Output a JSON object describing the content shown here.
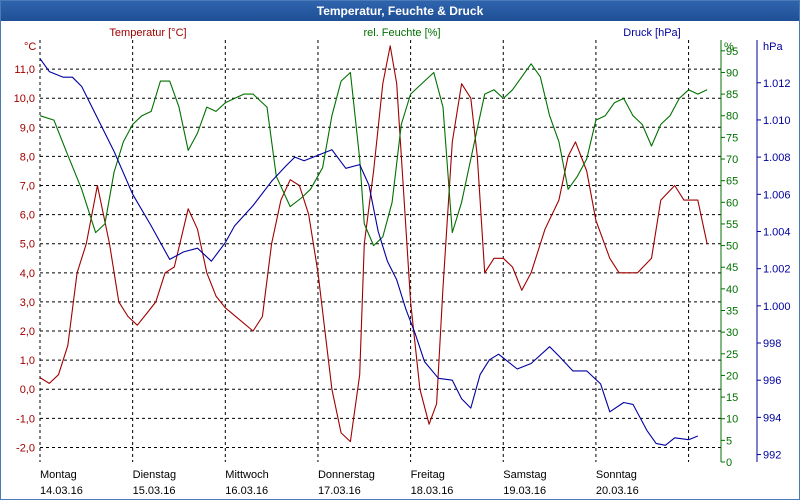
{
  "window": {
    "title": "Temperatur, Feuchte & Druck"
  },
  "colors": {
    "temp": "#a00000",
    "hum": "#007000",
    "press": "#0000a0",
    "grid": "#000000"
  },
  "chart_data": {
    "type": "line",
    "grid": true,
    "x": {
      "unit": "days",
      "range": [
        0,
        7.35
      ],
      "ticks": [
        {
          "value": 0,
          "day": "Montag",
          "date": "14.03.16"
        },
        {
          "value": 1,
          "day": "Dienstag",
          "date": "15.03.16"
        },
        {
          "value": 2,
          "day": "Mittwoch",
          "date": "16.03.16"
        },
        {
          "value": 3,
          "day": "Donnerstag",
          "date": "17.03.16"
        },
        {
          "value": 4,
          "day": "Freitag",
          "date": "18.03.16"
        },
        {
          "value": 5,
          "day": "Samstag",
          "date": "19.03.16"
        },
        {
          "value": 6,
          "day": "Sonntag",
          "date": "20.03.16"
        },
        {
          "value": 7,
          "day": "",
          "date": ""
        }
      ]
    },
    "axes": {
      "temp": {
        "unit_label": "°C",
        "range": [
          -2.5,
          12.0
        ],
        "ticks": [
          "-2,0",
          "-1,0",
          "0,0",
          "1,0",
          "2,0",
          "3,0",
          "4,0",
          "5,0",
          "6,0",
          "7,0",
          "8,0",
          "9,0",
          "10,0",
          "11,0"
        ]
      },
      "hum": {
        "unit_label": "%",
        "range": [
          0,
          97.5
        ],
        "ticks": [
          "0",
          "5",
          "10",
          "15",
          "20",
          "25",
          "30",
          "35",
          "40",
          "45",
          "50",
          "55",
          "60",
          "65",
          "70",
          "75",
          "80",
          "85",
          "90",
          "95"
        ]
      },
      "press": {
        "unit_label": "hPa",
        "range": [
          991.6,
          1014.3
        ],
        "ticks": [
          "992",
          "994",
          "996",
          "998",
          "1.000",
          "1.002",
          "1.004",
          "1.006",
          "1.008",
          "1.010",
          "1.012"
        ]
      }
    },
    "series": [
      {
        "name": "Temperatur [°C]",
        "axis": "temp",
        "points": [
          [
            0,
            0.4
          ],
          [
            0.1,
            0.2
          ],
          [
            0.2,
            0.5
          ],
          [
            0.3,
            1.5
          ],
          [
            0.4,
            4.0
          ],
          [
            0.5,
            5.0
          ],
          [
            0.62,
            7.0
          ],
          [
            0.75,
            5.0
          ],
          [
            0.85,
            3.0
          ],
          [
            0.95,
            2.5
          ],
          [
            1.05,
            2.2
          ],
          [
            1.15,
            2.6
          ],
          [
            1.25,
            3.0
          ],
          [
            1.35,
            4.0
          ],
          [
            1.45,
            4.2
          ],
          [
            1.6,
            6.2
          ],
          [
            1.7,
            5.5
          ],
          [
            1.8,
            4.0
          ],
          [
            1.9,
            3.2
          ],
          [
            2.0,
            2.8
          ],
          [
            2.15,
            2.4
          ],
          [
            2.3,
            2.0
          ],
          [
            2.4,
            2.5
          ],
          [
            2.5,
            5.0
          ],
          [
            2.6,
            6.5
          ],
          [
            2.7,
            7.2
          ],
          [
            2.8,
            7.0
          ],
          [
            2.9,
            6.0
          ],
          [
            3.0,
            4.0
          ],
          [
            3.15,
            0.0
          ],
          [
            3.25,
            -1.5
          ],
          [
            3.35,
            -1.8
          ],
          [
            3.45,
            0.5
          ],
          [
            3.5,
            5.0
          ],
          [
            3.6,
            7.5
          ],
          [
            3.7,
            10.5
          ],
          [
            3.78,
            11.8
          ],
          [
            3.85,
            10.5
          ],
          [
            3.92,
            7.0
          ],
          [
            4.0,
            3.0
          ],
          [
            4.1,
            0.0
          ],
          [
            4.2,
            -1.2
          ],
          [
            4.28,
            -0.5
          ],
          [
            4.35,
            3.5
          ],
          [
            4.45,
            8.5
          ],
          [
            4.55,
            10.5
          ],
          [
            4.65,
            10.0
          ],
          [
            4.72,
            8.0
          ],
          [
            4.8,
            4.0
          ],
          [
            4.9,
            4.5
          ],
          [
            5.0,
            4.5
          ],
          [
            5.1,
            4.2
          ],
          [
            5.2,
            3.4
          ],
          [
            5.3,
            4.0
          ],
          [
            5.45,
            5.5
          ],
          [
            5.6,
            6.5
          ],
          [
            5.7,
            8.0
          ],
          [
            5.78,
            8.5
          ],
          [
            5.9,
            7.5
          ],
          [
            6.0,
            5.8
          ],
          [
            6.15,
            4.5
          ],
          [
            6.25,
            4.0
          ],
          [
            6.45,
            4.0
          ],
          [
            6.6,
            4.5
          ],
          [
            6.7,
            6.5
          ],
          [
            6.85,
            7.0
          ],
          [
            6.95,
            6.5
          ],
          [
            7.1,
            6.5
          ],
          [
            7.2,
            5.0
          ]
        ]
      },
      {
        "name": "rel. Feuchte [%]",
        "axis": "hum",
        "points": [
          [
            0,
            80
          ],
          [
            0.15,
            79
          ],
          [
            0.28,
            72
          ],
          [
            0.45,
            63
          ],
          [
            0.6,
            53
          ],
          [
            0.7,
            55
          ],
          [
            0.8,
            67
          ],
          [
            0.9,
            74
          ],
          [
            1.0,
            78
          ],
          [
            1.1,
            80
          ],
          [
            1.2,
            81
          ],
          [
            1.3,
            88
          ],
          [
            1.4,
            88
          ],
          [
            1.5,
            82
          ],
          [
            1.6,
            72
          ],
          [
            1.7,
            76
          ],
          [
            1.8,
            82
          ],
          [
            1.9,
            81
          ],
          [
            2.0,
            83
          ],
          [
            2.1,
            84
          ],
          [
            2.2,
            85
          ],
          [
            2.3,
            85
          ],
          [
            2.45,
            82
          ],
          [
            2.55,
            66
          ],
          [
            2.7,
            59
          ],
          [
            2.82,
            61
          ],
          [
            2.92,
            63
          ],
          [
            3.05,
            68
          ],
          [
            3.15,
            80
          ],
          [
            3.25,
            88
          ],
          [
            3.35,
            90
          ],
          [
            3.45,
            70
          ],
          [
            3.5,
            55
          ],
          [
            3.6,
            50
          ],
          [
            3.7,
            52
          ],
          [
            3.8,
            60
          ],
          [
            3.9,
            78
          ],
          [
            4.0,
            85
          ],
          [
            4.15,
            88
          ],
          [
            4.25,
            90
          ],
          [
            4.35,
            82
          ],
          [
            4.45,
            53
          ],
          [
            4.55,
            60
          ],
          [
            4.65,
            70
          ],
          [
            4.8,
            85
          ],
          [
            4.9,
            86
          ],
          [
            5.0,
            84
          ],
          [
            5.1,
            86
          ],
          [
            5.2,
            89
          ],
          [
            5.3,
            92
          ],
          [
            5.4,
            89
          ],
          [
            5.5,
            80
          ],
          [
            5.6,
            74
          ],
          [
            5.7,
            63
          ],
          [
            5.8,
            66
          ],
          [
            5.9,
            70
          ],
          [
            6.0,
            79
          ],
          [
            6.1,
            80
          ],
          [
            6.2,
            83
          ],
          [
            6.3,
            84
          ],
          [
            6.4,
            80
          ],
          [
            6.5,
            78
          ],
          [
            6.6,
            73
          ],
          [
            6.7,
            78
          ],
          [
            6.8,
            80
          ],
          [
            6.9,
            84
          ],
          [
            7.0,
            86
          ],
          [
            7.1,
            85
          ],
          [
            7.2,
            86
          ]
        ]
      },
      {
        "name": "Druck [hPa]",
        "axis": "press",
        "points": [
          [
            0,
            1013.3
          ],
          [
            0.1,
            1012.6
          ],
          [
            0.25,
            1012.3
          ],
          [
            0.35,
            1012.3
          ],
          [
            0.45,
            1011.8
          ],
          [
            0.6,
            1010.3
          ],
          [
            0.8,
            1008.3
          ],
          [
            1.0,
            1006.0
          ],
          [
            1.2,
            1004.3
          ],
          [
            1.4,
            1002.5
          ],
          [
            1.55,
            1002.9
          ],
          [
            1.7,
            1003.1
          ],
          [
            1.85,
            1002.4
          ],
          [
            2.0,
            1003.4
          ],
          [
            2.1,
            1004.3
          ],
          [
            2.3,
            1005.4
          ],
          [
            2.5,
            1006.7
          ],
          [
            2.65,
            1007.5
          ],
          [
            2.75,
            1008.0
          ],
          [
            2.85,
            1007.8
          ],
          [
            3.0,
            1008.1
          ],
          [
            3.15,
            1008.4
          ],
          [
            3.3,
            1007.4
          ],
          [
            3.45,
            1007.6
          ],
          [
            3.55,
            1006.5
          ],
          [
            3.65,
            1004.0
          ],
          [
            3.75,
            1002.4
          ],
          [
            3.85,
            1001.4
          ],
          [
            3.95,
            999.8
          ],
          [
            4.05,
            998.5
          ],
          [
            4.15,
            997.0
          ],
          [
            4.3,
            996.1
          ],
          [
            4.45,
            996.0
          ],
          [
            4.55,
            995.0
          ],
          [
            4.65,
            994.5
          ],
          [
            4.75,
            996.3
          ],
          [
            4.85,
            997.1
          ],
          [
            4.95,
            997.4
          ],
          [
            5.05,
            997.0
          ],
          [
            5.15,
            996.6
          ],
          [
            5.3,
            996.9
          ],
          [
            5.5,
            997.8
          ],
          [
            5.6,
            997.3
          ],
          [
            5.75,
            996.5
          ],
          [
            5.9,
            996.5
          ],
          [
            6.05,
            995.8
          ],
          [
            6.15,
            994.3
          ],
          [
            6.3,
            994.8
          ],
          [
            6.4,
            994.7
          ],
          [
            6.55,
            993.3
          ],
          [
            6.65,
            992.6
          ],
          [
            6.75,
            992.5
          ],
          [
            6.85,
            992.9
          ],
          [
            7.0,
            992.8
          ],
          [
            7.1,
            993.0
          ]
        ]
      }
    ]
  }
}
